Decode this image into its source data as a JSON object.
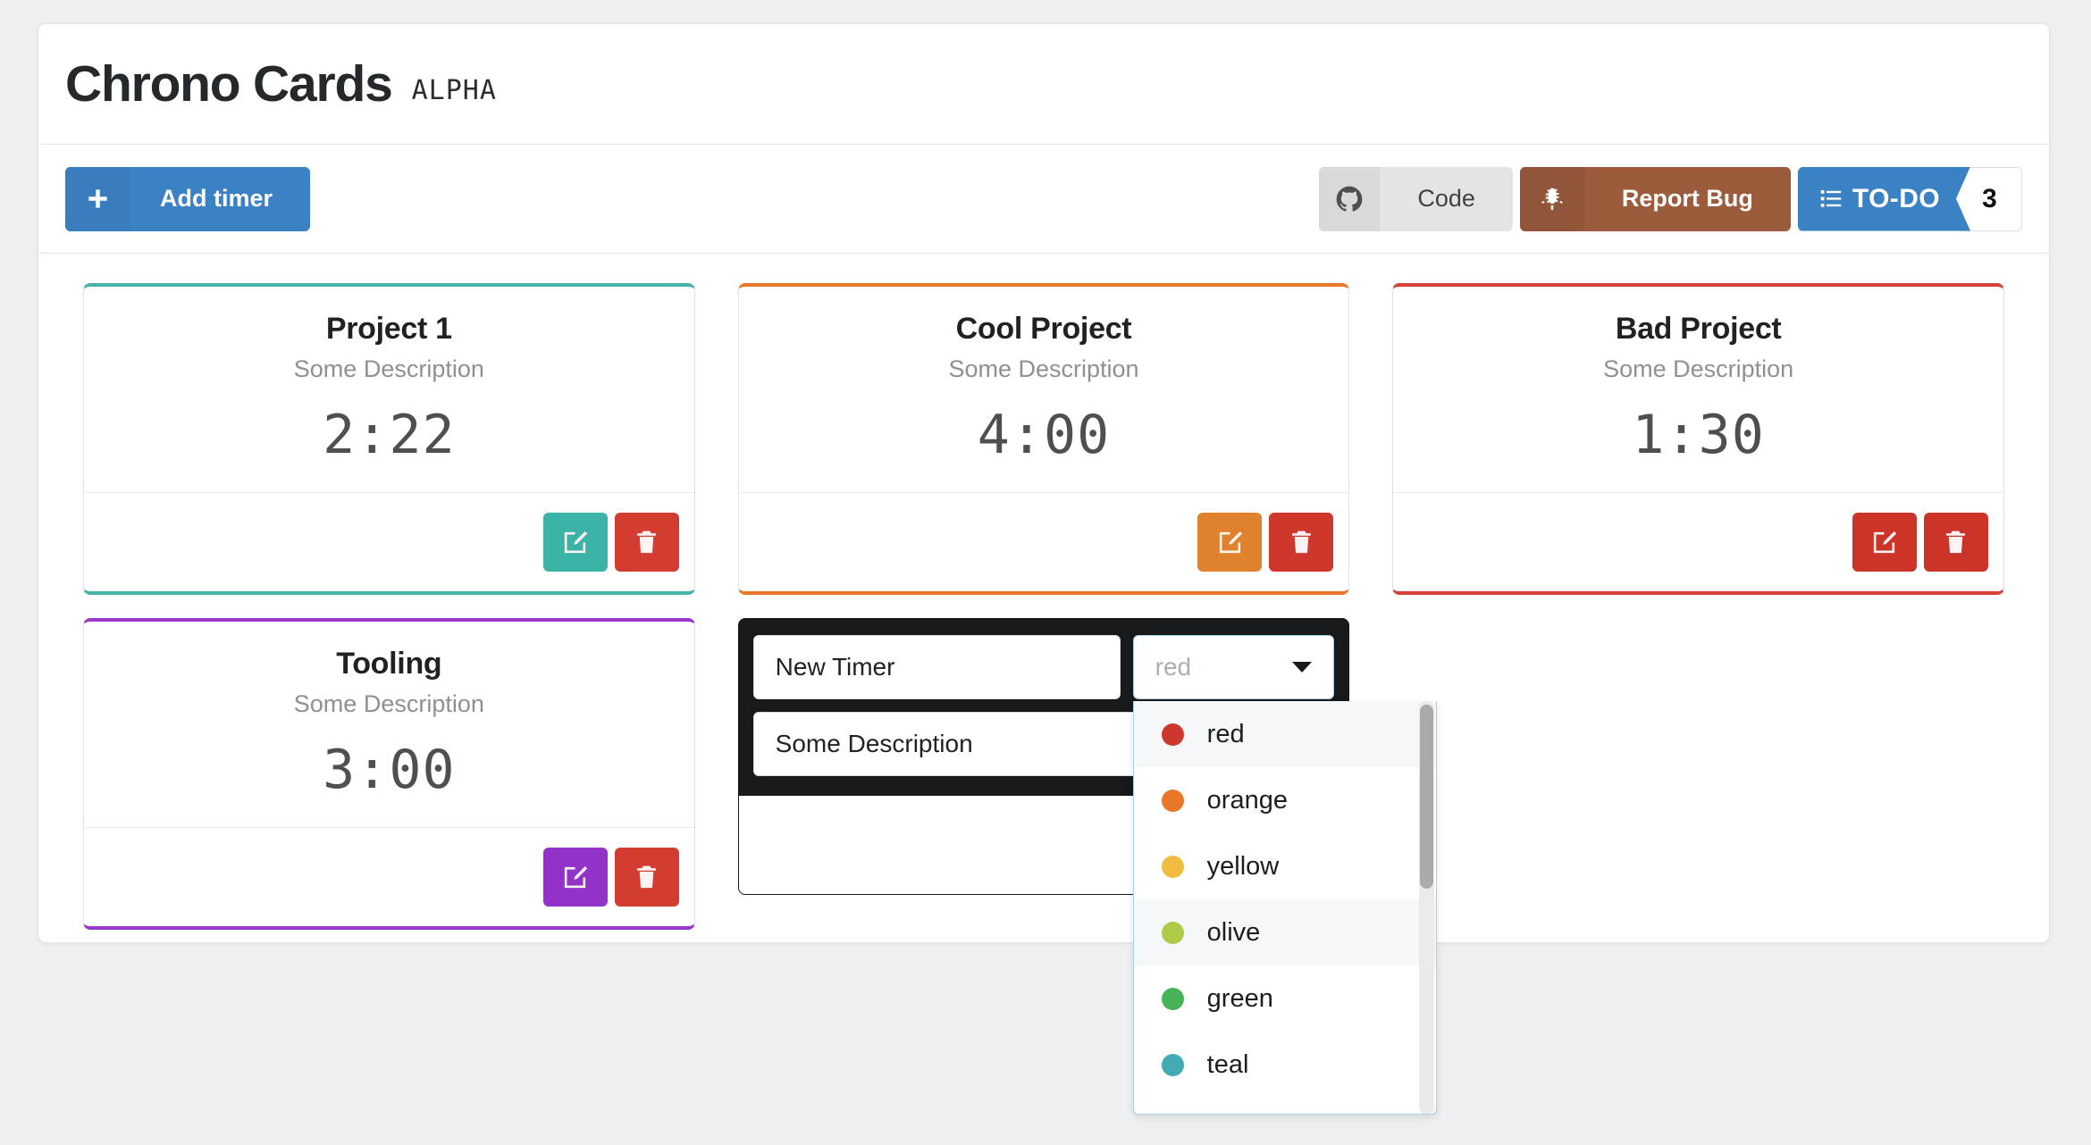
{
  "header": {
    "title": "Chrono Cards",
    "alpha_badge": "ALPHA"
  },
  "toolbar": {
    "add_timer_label": "Add timer",
    "add_timer_icon": "plus-icon",
    "code_label": "Code",
    "code_icon": "github-icon",
    "report_bug_label": "Report Bug",
    "report_bug_icon": "bug-icon",
    "todo_label": "TO-DO",
    "todo_icon": "list-icon",
    "todo_count": "3",
    "colors": {
      "add_timer": "#3b82c4",
      "code": "#e2e4e5",
      "report_bug": "#9c5c3c",
      "todo": "#3b82c4"
    }
  },
  "cards": [
    {
      "title": "Project 1",
      "description": "Some Description",
      "time": "2:22",
      "accent": "#46b3a8",
      "edit_color": "#3cb3a7",
      "delete_color": "#d33c31",
      "edit_icon": "edit-pencil-icon",
      "delete_icon": "trash-icon"
    },
    {
      "title": "Cool Project",
      "description": "Some Description",
      "time": "4:00",
      "accent": "#e8772a",
      "edit_color": "#e0812e",
      "delete_color": "#cf372d",
      "edit_icon": "edit-pencil-icon",
      "delete_icon": "trash-icon"
    },
    {
      "title": "Bad Project",
      "description": "Some Description",
      "time": "1:30",
      "accent": "#d64036",
      "edit_color": "#cc342a",
      "delete_color": "#cc342a",
      "edit_icon": "edit-pencil-icon",
      "delete_icon": "trash-icon"
    },
    {
      "title": "Tooling",
      "description": "Some Description",
      "time": "3:00",
      "accent": "#9a38cc",
      "edit_color": "#9232c9",
      "delete_color": "#d33c31",
      "edit_icon": "edit-pencil-icon",
      "delete_icon": "trash-icon"
    }
  ],
  "form": {
    "name_value": "New Timer",
    "name_placeholder": "New Timer",
    "description_value": "Some Description",
    "description_placeholder": "Some Description",
    "color_select_value": "red",
    "caret_icon": "chevron-down-icon",
    "options": [
      {
        "label": "red",
        "swatch": "#cc382d"
      },
      {
        "label": "orange",
        "swatch": "#e8772a"
      },
      {
        "label": "yellow",
        "swatch": "#f0bc40"
      },
      {
        "label": "olive",
        "swatch": "#aecb48"
      },
      {
        "label": "green",
        "swatch": "#45b356"
      },
      {
        "label": "teal",
        "swatch": "#41aab2"
      }
    ]
  }
}
